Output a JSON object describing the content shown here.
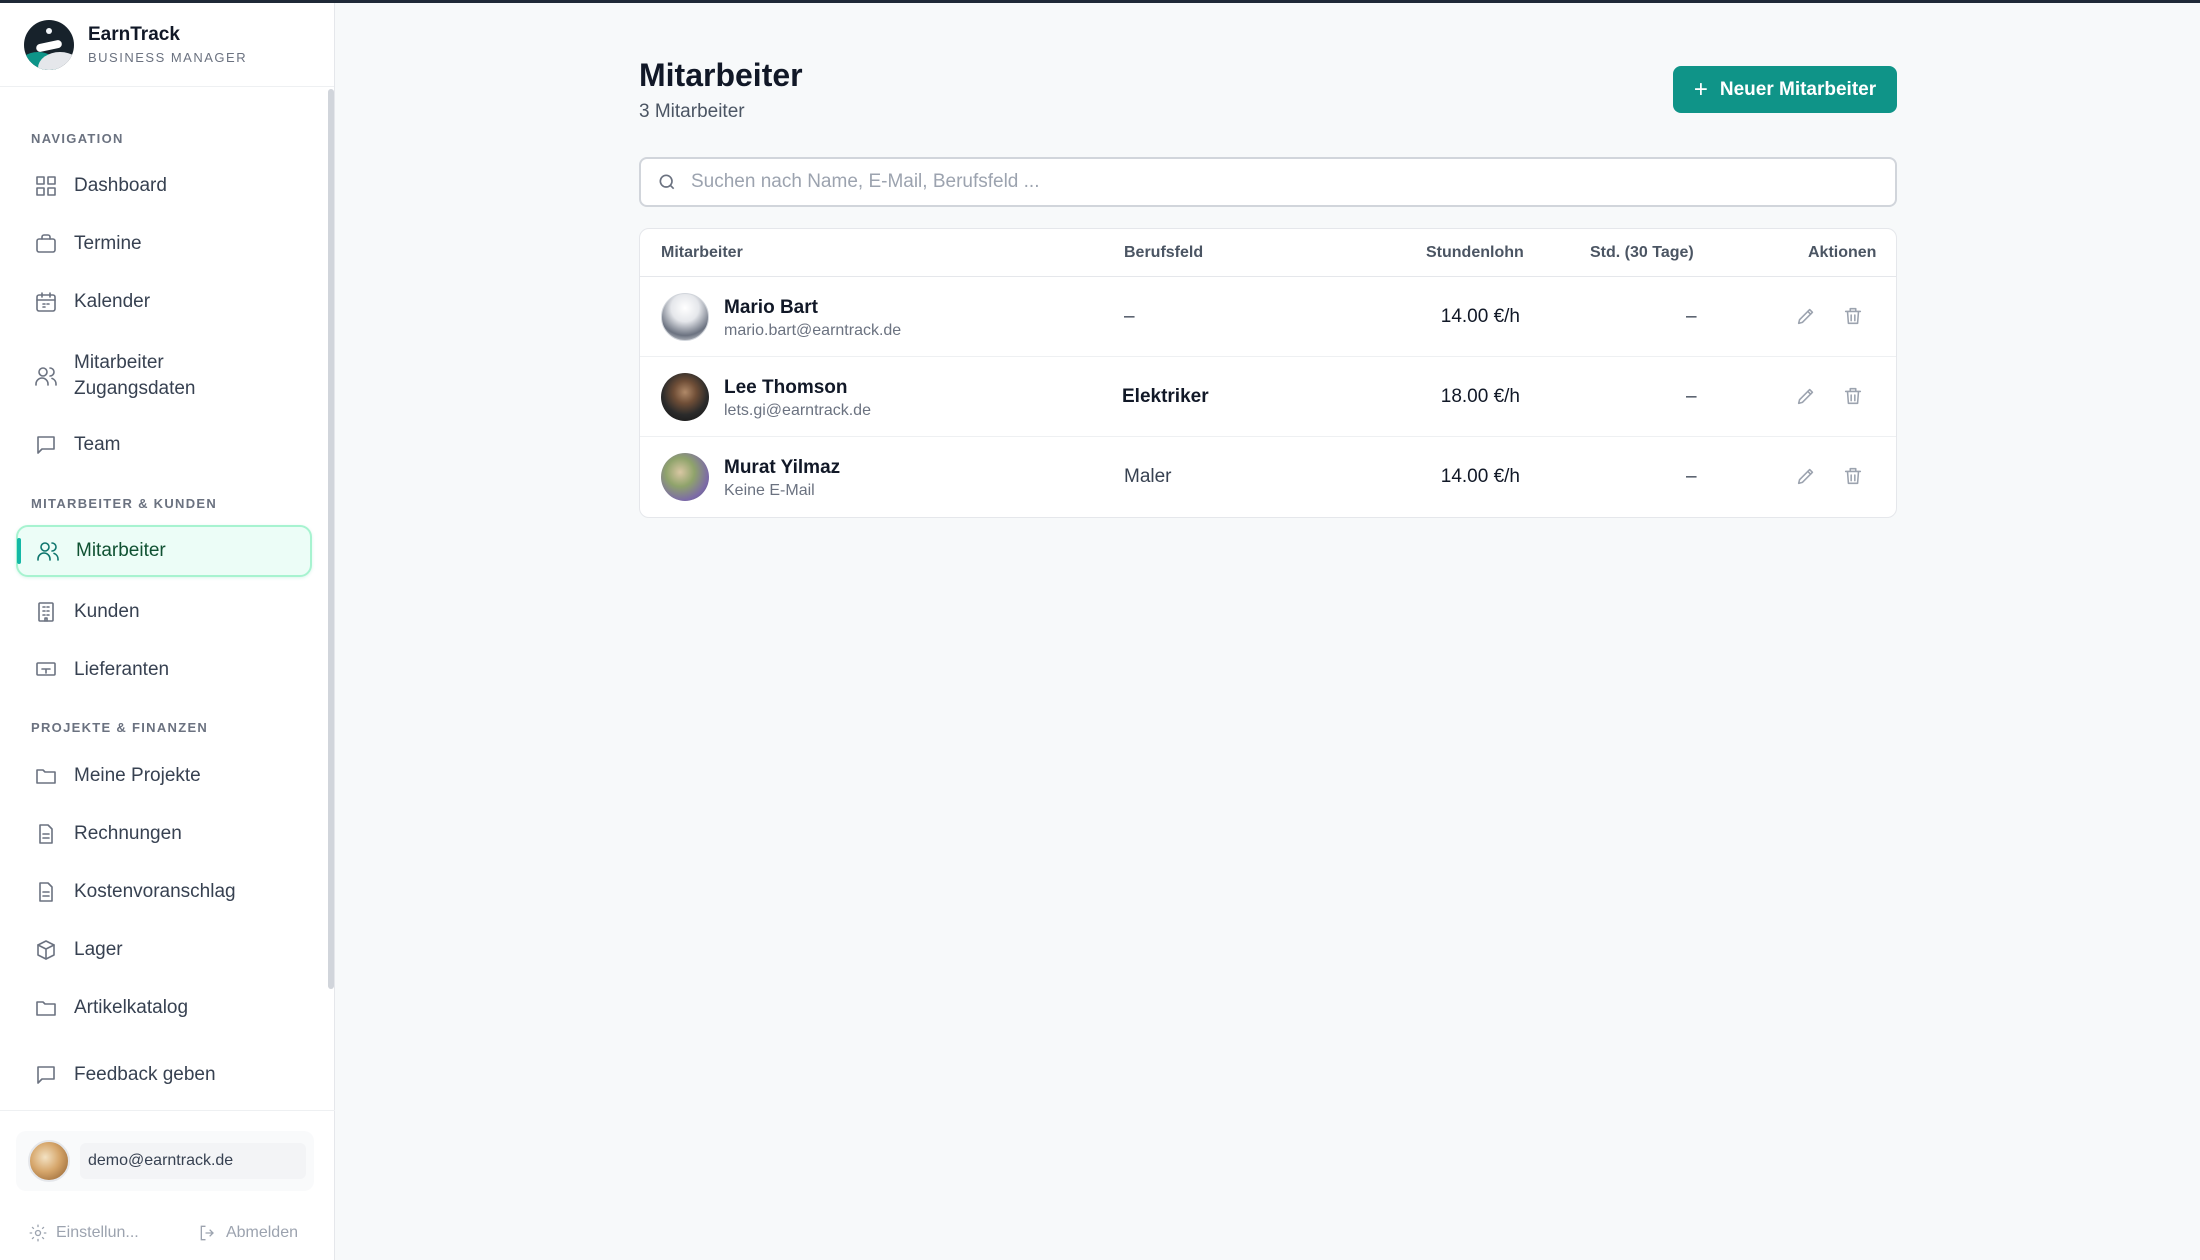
{
  "brand": {
    "name": "EarnTrack",
    "subtitle": "BUSINESS MANAGER"
  },
  "sidebar": {
    "sections": [
      {
        "label": "NAVIGATION"
      },
      {
        "label": "MITARBEITER & KUNDEN"
      },
      {
        "label": "PROJEKTE & FINANZEN"
      }
    ],
    "items": [
      {
        "label": "Dashboard",
        "icon": "grid-icon"
      },
      {
        "label": "Termine",
        "icon": "briefcase-icon"
      },
      {
        "label": "Kalender",
        "icon": "calendar-icon"
      },
      {
        "label": "Mitarbeiter Zugangsdaten",
        "icon": "users-icon"
      },
      {
        "label": "Team",
        "icon": "chat-icon"
      },
      {
        "label": "Mitarbeiter",
        "icon": "users-icon",
        "active": true
      },
      {
        "label": "Kunden",
        "icon": "building-icon"
      },
      {
        "label": "Lieferanten",
        "icon": "truck-icon"
      },
      {
        "label": "Meine Projekte",
        "icon": "folder-icon"
      },
      {
        "label": "Rechnungen",
        "icon": "document-icon"
      },
      {
        "label": "Kostenvoranschlag",
        "icon": "document-icon"
      },
      {
        "label": "Lager",
        "icon": "box-icon"
      },
      {
        "label": "Artikelkatalog",
        "icon": "folder-icon"
      },
      {
        "label": "Feedback geben",
        "icon": "chat-icon"
      }
    ],
    "user": {
      "email": "demo@earntrack.de"
    },
    "settings_label": "Einstellun...",
    "logout_label": "Abmelden"
  },
  "main": {
    "title": "Mitarbeiter",
    "subtitle": "3 Mitarbeiter",
    "new_button_label": "Neuer Mitarbeiter",
    "search": {
      "placeholder": "Suchen nach Name, E-Mail, Berufsfeld ...",
      "value": ""
    },
    "table": {
      "headers": {
        "employee": "Mitarbeiter",
        "field": "Berufsfeld",
        "rate": "Stundenlohn",
        "hours": "Std. (30 Tage)",
        "actions": "Aktionen"
      },
      "rows": [
        {
          "name": "Mario Bart",
          "email": "mario.bart@earntrack.de",
          "field": "–",
          "rate": "14.00 €/h",
          "hours": "–"
        },
        {
          "name": "Lee Thomson",
          "email": "lets.gi@earntrack.de",
          "field": "Elektriker",
          "rate": "18.00 €/h",
          "hours": "–"
        },
        {
          "name": "Murat Yilmaz",
          "email": "Keine E-Mail",
          "field": "Maler",
          "rate": "14.00 €/h",
          "hours": "–"
        }
      ]
    }
  },
  "colors": {
    "accent": "#0f9488",
    "active_bg": "#ecfdf7",
    "active_border": "#a7f3d0"
  }
}
